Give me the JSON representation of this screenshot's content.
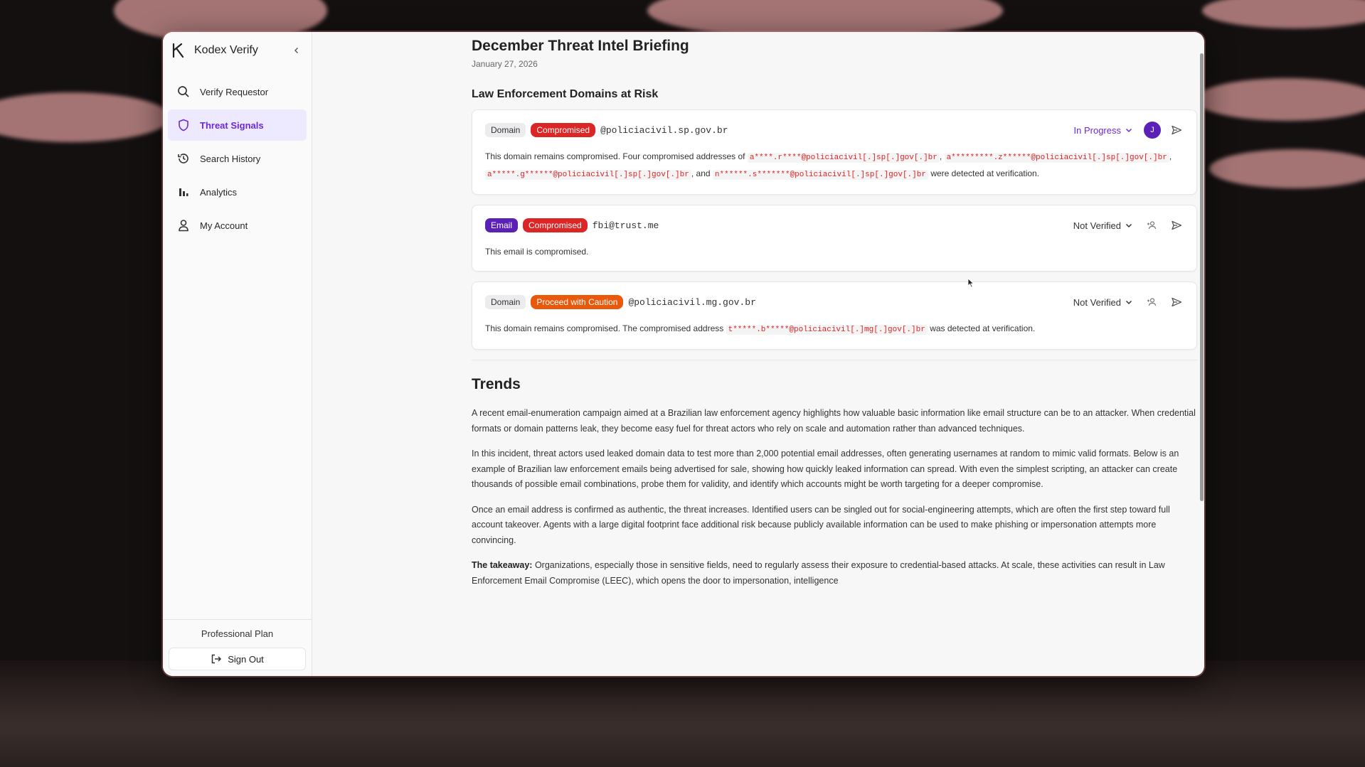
{
  "app": {
    "brand_name": "Kodex Verify"
  },
  "sidebar": {
    "items": [
      {
        "label": "Verify Requestor",
        "icon": "search-icon",
        "active": false
      },
      {
        "label": "Threat Signals",
        "icon": "shield-icon",
        "active": true
      },
      {
        "label": "Search History",
        "icon": "history-icon",
        "active": false
      },
      {
        "label": "Analytics",
        "icon": "bar-chart-icon",
        "active": false
      },
      {
        "label": "My Account",
        "icon": "user-icon",
        "active": false
      }
    ],
    "plan_label": "Professional Plan",
    "sign_out_label": "Sign Out"
  },
  "briefing": {
    "title": "December Threat Intel Briefing",
    "date": "January 27, 2026",
    "section_title": "Law Enforcement Domains at Risk",
    "cards": [
      {
        "type_label": "Domain",
        "status_label": "Compromised",
        "target": "@policiacivil.sp.gov.br",
        "verification_status": "In Progress",
        "assignee_initial": "J",
        "body_intro": "This domain remains compromised. Four compromised addresses of",
        "addresses": [
          "a****.r****@policiacivil[.]sp[.]gov[.]br",
          "a*********.z******@policiacivil[.]sp[.]gov[.]br",
          "a*****.g******@policiacivil[.]sp[.]gov[.]br",
          "n******.s*******@policiacivil[.]sp[.]gov[.]br"
        ],
        "sep_1": ",",
        "sep_2": ",",
        "sep_3": ", and",
        "body_outro": "were detected at verification."
      },
      {
        "type_label": "Email",
        "status_label": "Compromised",
        "target": "fbi@trust.me",
        "verification_status": "Not Verified",
        "body": "This email is compromised."
      },
      {
        "type_label": "Domain",
        "status_label": "Proceed with Caution",
        "target": "@policiacivil.mg.gov.br",
        "verification_status": "Not Verified",
        "body_intro": "This domain remains compromised. The compromised address",
        "address": "t*****.b*****@policiacivil[.]mg[.]gov[.]br",
        "body_outro": "was detected at verification."
      }
    ]
  },
  "trends": {
    "title": "Trends",
    "paragraphs": [
      "A recent email-enumeration campaign aimed at a Brazilian law enforcement agency highlights how valuable basic information like email structure can be to an attacker. When credential formats or domain patterns leak, they become easy fuel for threat actors who rely on scale and automation rather than advanced techniques.",
      "In this incident, threat actors used leaked domain data to test more than 2,000 potential email addresses, often generating usernames at random to mimic valid formats. Below is an example of Brazilian law enforcement emails being advertised for sale, showing how quickly leaked information can spread. With even the simplest scripting, an attacker can create thousands of possible email combinations, probe them for validity, and identify which accounts might be worth targeting for a deeper compromise.",
      "Once an email address is confirmed as authentic, the threat increases. Identified users can be singled out for social-engineering attempts, which are often the first step toward full account takeover. Agents with a large digital footprint face additional risk because publicly available information can be used to make phishing or impersonation attempts more convincing."
    ],
    "takeaway_label": "The takeaway:",
    "takeaway_text": " Organizations, especially those in sensitive fields, need to regularly assess their exposure to credential-based attacks. At scale, these activities can result in Law Enforcement Email Compromise (LEEC), which opens the door to impersonation, intelligence"
  },
  "colors": {
    "accent": "#6d28d9",
    "danger": "#dc2626",
    "caution": "#ea580c"
  }
}
